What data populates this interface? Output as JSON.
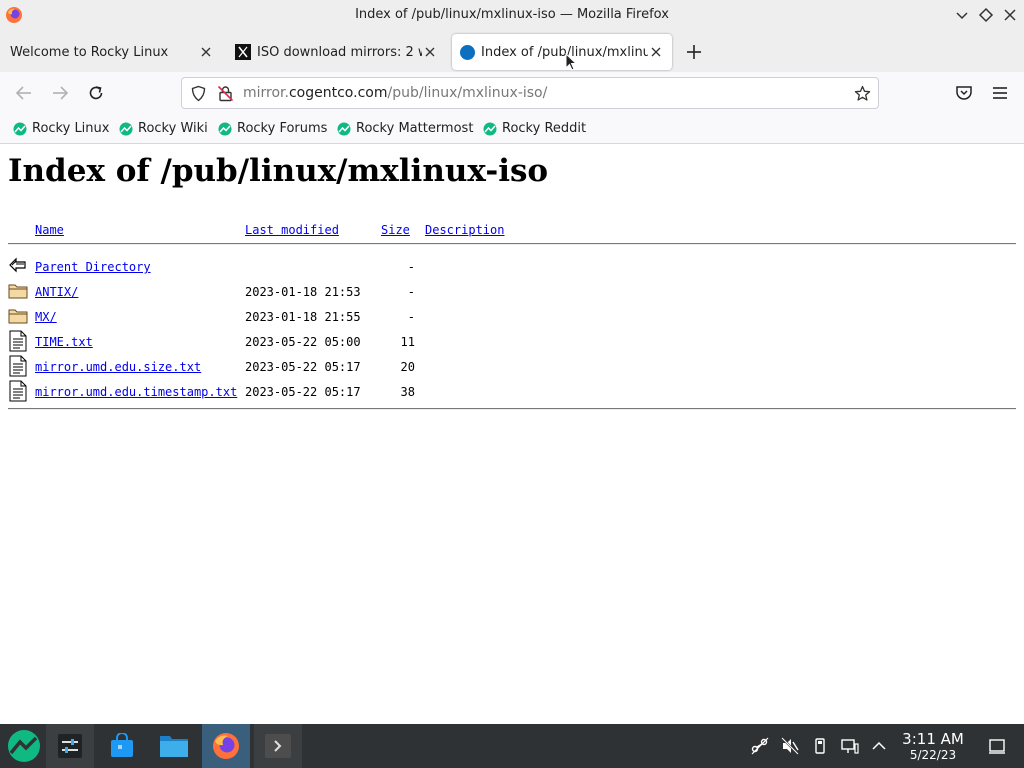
{
  "window": {
    "title": "Index of /pub/linux/mxlinux-iso — Mozilla Firefox"
  },
  "tabs": [
    {
      "label": "Welcome to Rocky Linux"
    },
    {
      "label": "ISO download mirrors: 2 w"
    },
    {
      "label": "Index of /pub/linux/mxlinux-iso/"
    }
  ],
  "navbar": {
    "url_prefix": "mirror.",
    "url_domain": "cogentco.com",
    "url_path": "/pub/linux/mxlinux-iso/"
  },
  "bookmarks": [
    {
      "label": "Rocky Linux"
    },
    {
      "label": "Rocky Wiki"
    },
    {
      "label": "Rocky Forums"
    },
    {
      "label": "Rocky Mattermost"
    },
    {
      "label": "Rocky Reddit"
    }
  ],
  "page": {
    "heading": "Index of /pub/linux/mxlinux-iso",
    "columns": {
      "name": "Name",
      "last_modified": "Last modified",
      "size": "Size",
      "description": "Description"
    },
    "rows": [
      {
        "name": "Parent Directory",
        "date": "",
        "size": "-",
        "icon": "back-icon"
      },
      {
        "name": "ANTIX/",
        "date": "2023-01-18 21:53",
        "size": "-",
        "icon": "folder-icon"
      },
      {
        "name": "MX/",
        "date": "2023-01-18 21:55",
        "size": "-",
        "icon": "folder-icon"
      },
      {
        "name": "TIME.txt",
        "date": "2023-05-22 05:00",
        "size": "11",
        "icon": "text-file-icon"
      },
      {
        "name": "mirror.umd.edu.size.txt",
        "date": "2023-05-22 05:17",
        "size": "20",
        "icon": "text-file-icon"
      },
      {
        "name": "mirror.umd.edu.timestamp.txt",
        "date": "2023-05-22 05:17",
        "size": "38",
        "icon": "text-file-icon"
      }
    ]
  },
  "taskbar": {
    "time": "3:11 AM",
    "date": "5/22/23"
  },
  "colors": {
    "link": "#0000ee",
    "rocky_green": "#10b981",
    "taskbar": "#2f3235",
    "active_task": "#3a5f7d"
  }
}
